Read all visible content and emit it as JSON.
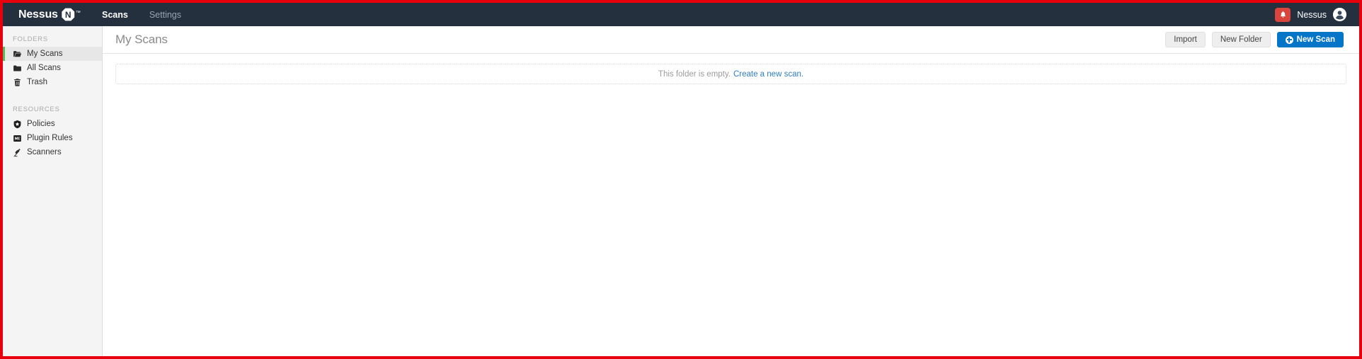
{
  "topbar": {
    "brand_name": "Nessus",
    "brand_badge_letter": "N",
    "brand_trademark": "™",
    "nav": [
      {
        "label": "Scans",
        "active": true
      },
      {
        "label": "Settings",
        "active": false
      }
    ],
    "notification_icon": "bell-icon",
    "user_name": "Nessus",
    "avatar_icon": "user-avatar-icon",
    "background_color": "#25303f",
    "notification_color": "#d9453d"
  },
  "sidebar": {
    "folders_heading": "FOLDERS",
    "resources_heading": "RESOURCES",
    "folders": [
      {
        "label": "My Scans",
        "icon": "open-folder-icon",
        "active": true
      },
      {
        "label": "All Scans",
        "icon": "folder-icon",
        "active": false
      },
      {
        "label": "Trash",
        "icon": "trash-icon",
        "active": false
      }
    ],
    "resources": [
      {
        "label": "Policies",
        "icon": "shield-badge-icon",
        "active": false
      },
      {
        "label": "Plugin Rules",
        "icon": "plugin-square-icon",
        "active": false
      },
      {
        "label": "Scanners",
        "icon": "radar-dish-icon",
        "active": false
      }
    ],
    "active_accent_color": "#5cb85c",
    "background_color": "#f4f4f4"
  },
  "content": {
    "page_title": "My Scans",
    "actions": {
      "import_label": "Import",
      "new_folder_label": "New Folder",
      "new_scan_label": "New Scan",
      "new_scan_icon": "plus-circle-icon",
      "primary_color": "#0575c8"
    },
    "empty_state": {
      "message": "This folder is empty.",
      "link_label": "Create a new scan.",
      "link_color": "#2f7ec1"
    }
  },
  "annotation": {
    "frame_color": "#e8000d"
  }
}
